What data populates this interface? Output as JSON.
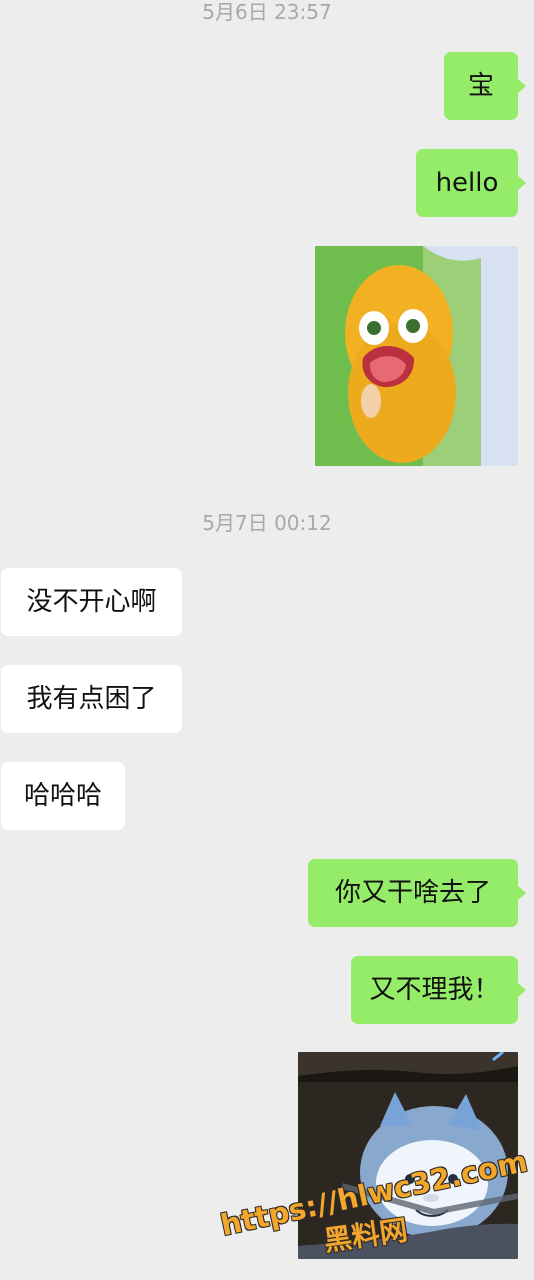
{
  "chat": {
    "timestamps": {
      "first": "5月6日 23:57",
      "second": "5月7日 00:12"
    },
    "messages": [
      {
        "side": "right",
        "text": "宝"
      },
      {
        "side": "right",
        "text": "hello"
      },
      {
        "side": "right",
        "text": "没不开心啊"
      },
      {
        "side": "right",
        "text": "我有点困了"
      },
      {
        "side": "right",
        "text": "哈哈哈"
      },
      {
        "side": "right",
        "text": "你又干啥去了"
      },
      {
        "side": "right",
        "text": "又不理我！"
      }
    ],
    "left_messages": [
      "没不开心啊",
      "我有点困了",
      "哈哈哈"
    ],
    "right_messages": [
      "宝",
      "hello",
      "你又干啥去了",
      "又不理我！"
    ]
  },
  "watermark": {
    "url_text": "https://hlwc32.com",
    "name_text": "黑料网"
  },
  "colors": {
    "background": "#ededed",
    "outgoing_bubble": "#95ec69",
    "incoming_bubble": "#ffffff",
    "watermark": "#f2a72c"
  }
}
